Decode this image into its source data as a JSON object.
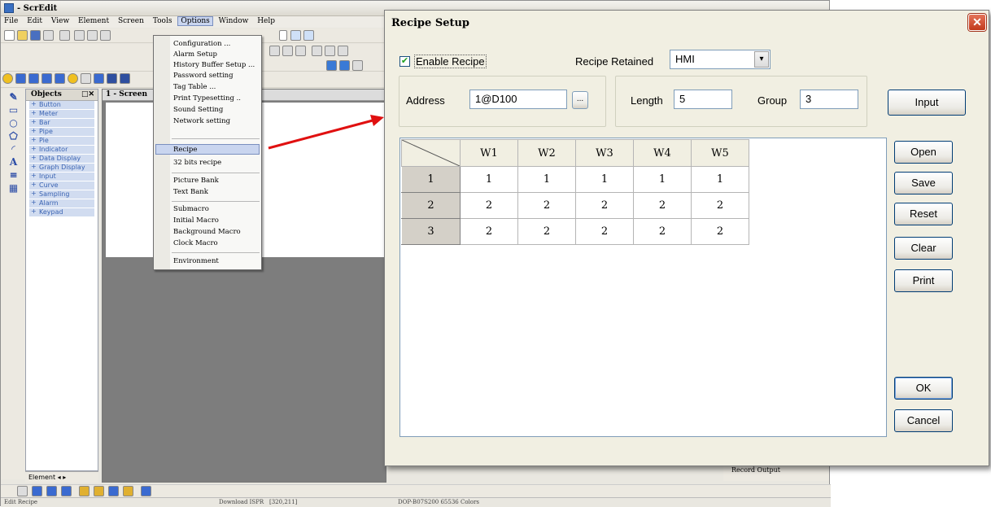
{
  "app": {
    "title": "- ScrEdit",
    "menu": [
      "File",
      "Edit",
      "View",
      "Element",
      "Screen",
      "Tools",
      "Options",
      "Window",
      "Help"
    ],
    "active_menu": "Options",
    "objects_panel": {
      "title": "Objects",
      "items": [
        "Button",
        "Meter",
        "Bar",
        "Pipe",
        "Pie",
        "Indicator",
        "Data Display",
        "Graph Display",
        "Input",
        "Curve",
        "Sampling",
        "Alarm",
        "Keypad"
      ]
    },
    "panel_tab": "Element",
    "screen_title": "1 - Screen",
    "status": {
      "left": "Edit Recipe",
      "download": "Download ISPR",
      "coords": "[320,211]",
      "model": "DOP-B07S200 65536 Colors"
    },
    "right_tabs": "Record  Output"
  },
  "options_menu": {
    "items": [
      "Configuration ...",
      "Alarm Setup",
      "History Buffer Setup ...",
      "Password setting",
      "Tag Table ...",
      "Print Typesetting ..",
      "Sound Setting",
      "Network setting",
      "Recipe",
      "32 bits recipe",
      "Picture Bank",
      "Text Bank",
      "Submacro",
      "Initial Macro",
      "Background Macro",
      "Clock Macro",
      "Environment"
    ],
    "highlighted": "Recipe"
  },
  "dialog": {
    "title": "Recipe Setup",
    "close_glyph": "✕",
    "enable_recipe_label": "Enable Recipe",
    "enable_recipe_checked": true,
    "recipe_retained_label": "Recipe Retained",
    "recipe_retained_value": "HMI",
    "address_label": "Address",
    "address_value": "1@D100",
    "browse_label": "...",
    "length_label": "Length",
    "length_value": "5",
    "group_label": "Group",
    "group_value": "3",
    "input_button": "Input",
    "buttons": {
      "open": "Open",
      "save": "Save",
      "reset": "Reset",
      "clear": "Clear",
      "print": "Print",
      "ok": "OK",
      "cancel": "Cancel"
    },
    "table": {
      "columns": [
        "W1",
        "W2",
        "W3",
        "W4",
        "W5"
      ],
      "rows": [
        {
          "label": "1",
          "values": [
            "1",
            "1",
            "1",
            "1",
            "1"
          ]
        },
        {
          "label": "2",
          "values": [
            "2",
            "2",
            "2",
            "2",
            "2"
          ]
        },
        {
          "label": "3",
          "values": [
            "2",
            "2",
            "2",
            "2",
            "2"
          ]
        }
      ]
    }
  },
  "colors": {
    "arrow": "#e01010",
    "menu_highlight": "#c9d5ef",
    "dialog_bg": "#f1efe2"
  }
}
